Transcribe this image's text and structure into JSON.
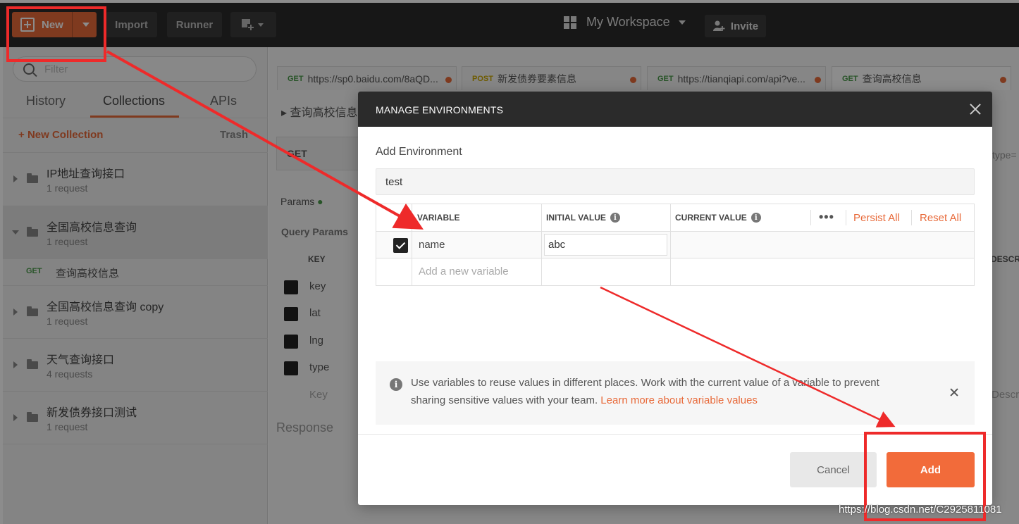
{
  "topbar": {
    "new_label": "New",
    "import_label": "Import",
    "runner_label": "Runner",
    "workspace_label": "My Workspace",
    "invite_label": "Invite"
  },
  "sidebar": {
    "filter_placeholder": "Filter",
    "tabs": [
      "History",
      "Collections",
      "APIs"
    ],
    "active_tab": "Collections",
    "new_collection": "New Collection",
    "trash": "Trash",
    "collections": [
      {
        "name": "IP地址查询接口",
        "count": "1 request"
      },
      {
        "name": "全国高校信息查询",
        "count": "1 request"
      },
      {
        "name": "全国高校信息查询 copy",
        "count": "1 request"
      },
      {
        "name": "天气查询接口",
        "count": "4 requests"
      },
      {
        "name": "新发债券接口测试",
        "count": "1 request"
      }
    ],
    "expanded_request": {
      "method": "GET",
      "name": "查询高校信息"
    }
  },
  "request_tabs": [
    {
      "method": "GET",
      "label": "https://sp0.baidu.com/8aQD..."
    },
    {
      "method": "POST",
      "label": "新发债券要素信息"
    },
    {
      "method": "GET",
      "label": "https://tianqiapi.com/api?ve..."
    },
    {
      "method": "GET",
      "label": "查询高校信息"
    }
  ],
  "background": {
    "breadcrumb": "查询高校信息",
    "method": "GET",
    "params_tab": "Params",
    "query_params": "Query Params",
    "key_header": "KEY",
    "keys": [
      "key",
      "lat",
      "lng",
      "type"
    ],
    "key_placeholder": "Key",
    "response": "Response",
    "descr_header": "DESCR",
    "descr_placeholder": "Descr",
    "url_tail": "type="
  },
  "modal": {
    "title": "MANAGE ENVIRONMENTS",
    "add_environment_label": "Add Environment",
    "env_name_value": "test",
    "columns": {
      "variable": "VARIABLE",
      "initial_value": "INITIAL VALUE",
      "current_value": "CURRENT VALUE"
    },
    "more_label": "•••",
    "persist_all": "Persist All",
    "reset_all": "Reset All",
    "rows": [
      {
        "variable": "name",
        "initial_value": "abc",
        "current_value": "",
        "checked": true
      }
    ],
    "new_variable_placeholder": "Add a new variable",
    "info_line1": "Use variables to reuse values in different places. Work with the current value of a variable to prevent",
    "info_line2_text": "sharing sensitive values with your team.",
    "info_link": "Learn more about variable values",
    "cancel_label": "Cancel",
    "add_label": "Add"
  },
  "watermark": "https://blog.csdn.net/C2925811081",
  "colors": {
    "accent": "#f26b3a",
    "annotation": "#ee2a2a",
    "topbar": "#2a2a2a"
  }
}
